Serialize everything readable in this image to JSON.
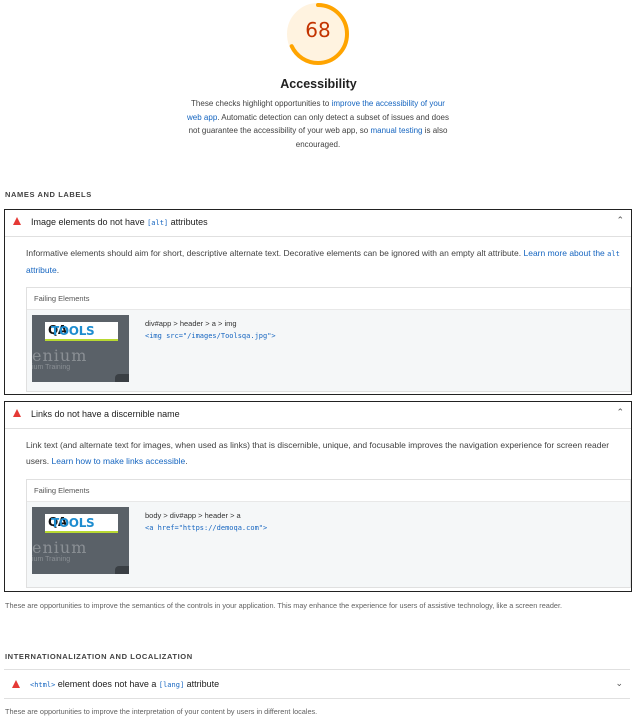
{
  "summary": {
    "score": "68",
    "title": "Accessibility",
    "desc_1": "These checks highlight opportunities to ",
    "desc_link_1": "improve the accessibility of your web app",
    "desc_2": ". Automatic detection can only detect a subset of issues and does not guarantee the accessibility of your web app, so ",
    "desc_link_2": "manual testing",
    "desc_3": " is also encouraged.",
    "gauge_fraction": 0.68,
    "gauge_color": "#ffa400"
  },
  "groups": {
    "names_labels": {
      "title": "NAMES AND LABELS",
      "footnote": "These are opportunities to improve the semantics of the controls in your application. This may enhance the experience for users of assistive technology, like a screen reader."
    },
    "i18n": {
      "title": "INTERNATIONALIZATION AND LOCALIZATION",
      "footnote": "These are opportunities to improve the interpretation of your content by users in different locales."
    }
  },
  "audits": {
    "img_alt": {
      "title_1": "Image elements do not have ",
      "title_code": "[alt]",
      "title_2": " attributes",
      "desc_1": "Informative elements should aim for short, descriptive alternate text. Decorative elements can be ignored with an empty alt attribute. ",
      "desc_link_1": "Learn more about the ",
      "desc_code": "alt",
      "desc_link_2": " attribute",
      "desc_end": ".",
      "failing_label": "Failing Elements",
      "node_path": "div#app > header > a > img",
      "node_snippet": "<img src=\"/images/Toolsqa.jpg\">"
    },
    "link_name": {
      "title": "Links do not have a discernible name",
      "desc_1": "Link text (and alternate text for images, when used as links) that is discernible, unique, and focusable improves the navigation experience for screen reader users. ",
      "desc_link": "Learn how to make links accessible",
      "desc_end": ".",
      "failing_label": "Failing Elements",
      "node_path": "body > div#app > header > a",
      "node_snippet": "<a href=\"https://demoqa.com\">"
    },
    "html_lang": {
      "title_code_1": "<html>",
      "title_1": " element does not have a ",
      "title_code_2": "[lang]",
      "title_2": " attribute"
    }
  },
  "thumbnail": {
    "logo_text_1": "TOOLS",
    "logo_text_2": "QA",
    "overlay_big": "enium",
    "overlay_small": "ium Training"
  }
}
